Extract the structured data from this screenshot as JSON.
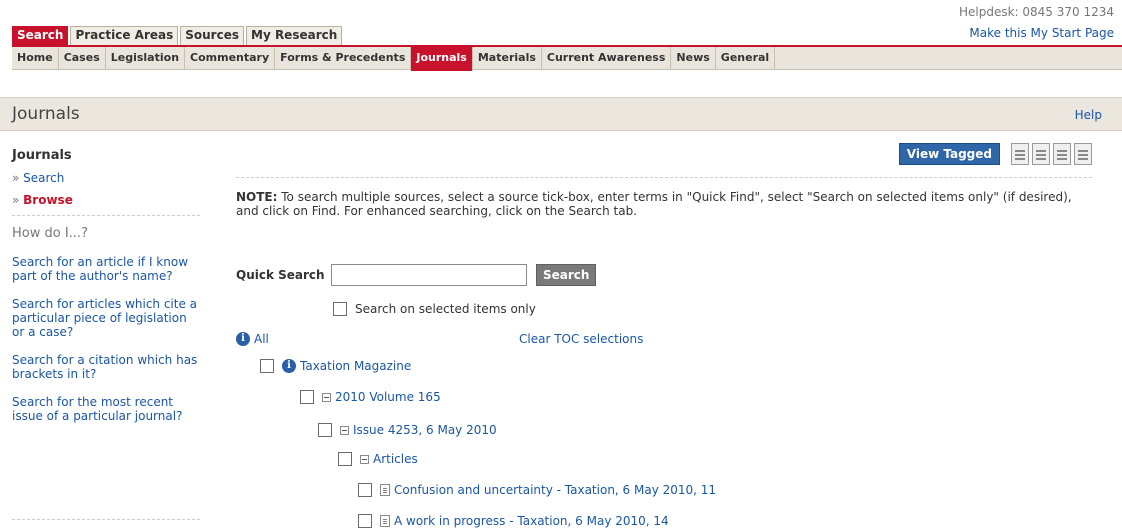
{
  "header": {
    "helpdesk": "Helpdesk: 0845 370 1234",
    "make_start_page": "Make this My Start Page"
  },
  "main_tabs": [
    {
      "label": "Search",
      "active": true
    },
    {
      "label": "Practice Areas",
      "active": false
    },
    {
      "label": "Sources",
      "active": false
    },
    {
      "label": "My Research",
      "active": false
    }
  ],
  "sub_nav": [
    {
      "label": "Home",
      "active": false
    },
    {
      "label": "Cases",
      "active": false
    },
    {
      "label": "Legislation",
      "active": false
    },
    {
      "label": "Commentary",
      "active": false
    },
    {
      "label": "Forms & Precedents",
      "active": false
    },
    {
      "label": "Journals",
      "active": true
    },
    {
      "label": "Materials",
      "active": false
    },
    {
      "label": "Current Awareness",
      "active": false
    },
    {
      "label": "News",
      "active": false
    },
    {
      "label": "General",
      "active": false
    }
  ],
  "page": {
    "title": "Journals",
    "help": "Help"
  },
  "sidebar": {
    "title": "Journals",
    "links": [
      {
        "label": "Search",
        "current": false
      },
      {
        "label": "Browse",
        "current": true
      }
    ],
    "how_title": "How do I...?",
    "how_links": [
      "Search for an article if I know part of the author's name?",
      "Search for articles which cite a particular piece of legislation or a case?",
      "Search for a citation which has brackets in it?",
      "Search for the most recent issue of a particular journal?"
    ]
  },
  "toolbar": {
    "view_tagged": "View Tagged",
    "icons": [
      "print-icon",
      "email-icon",
      "save-icon",
      "clipboard-link-icon"
    ]
  },
  "note": {
    "prefix": "NOTE:",
    "text": " To search multiple sources, select a source tick-box, enter terms in \"Quick Find\", select \"Search on selected items only\" (if desired), and click on Find. For enhanced searching, click on the Search tab."
  },
  "quick_search": {
    "label": "Quick Search",
    "value": "",
    "button": "Search",
    "selected_only": "Search on selected items only"
  },
  "tree": {
    "all": "All",
    "clear_toc": "Clear TOC selections",
    "journal": "Taxation Magazine",
    "volume": "2010 Volume 165",
    "issue": "Issue 4253, 6 May 2010",
    "section": "Articles",
    "articles": [
      "Confusion and uncertainty - Taxation, 6 May 2010, 11",
      "A work in progress - Taxation, 6 May 2010, 14"
    ]
  },
  "colors": {
    "accent_red": "#c8112a",
    "link_blue": "#1a56a8",
    "button_blue": "#2f66a8",
    "header_beige": "#ece7de"
  }
}
